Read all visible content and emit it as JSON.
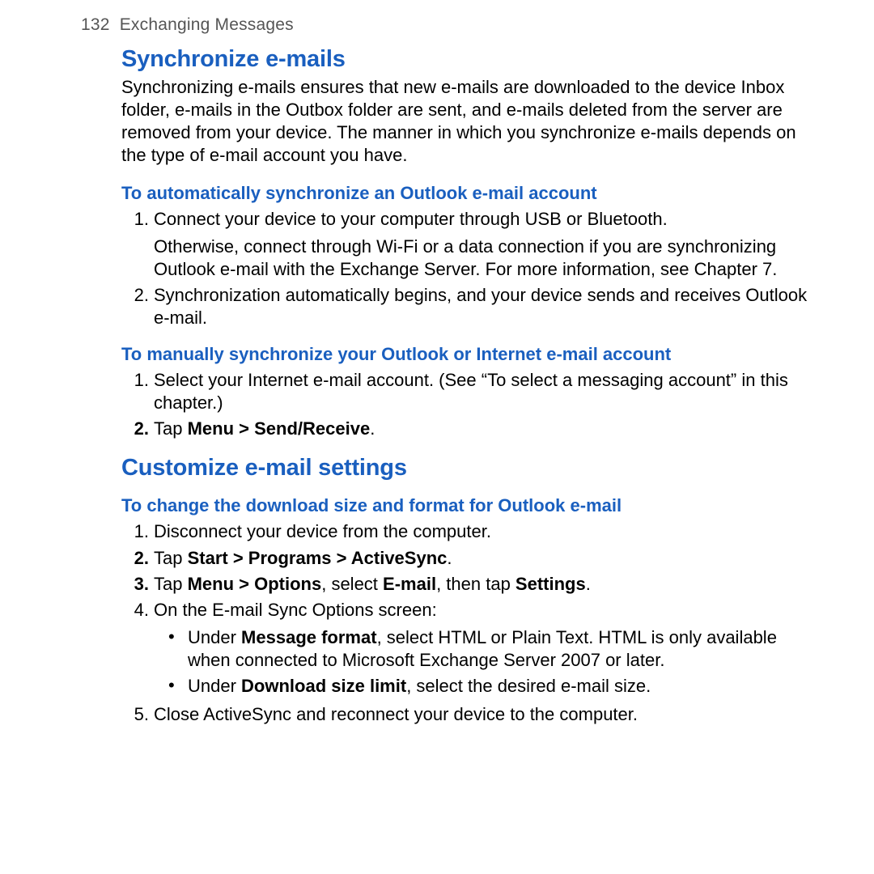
{
  "header": {
    "page_number": "132",
    "chapter": "Exchanging Messages"
  },
  "sections": [
    {
      "title": "Synchronize e-mails",
      "intro": "Synchronizing e-mails ensures that new e-mails are downloaded to the device Inbox folder, e-mails in the Outbox folder are sent, and e-mails deleted from the server are removed from your device. The manner in which you synchronize e-mails depends on the type of e-mail account you have.",
      "subs": [
        {
          "title": "To automatically synchronize an Outlook e-mail account",
          "items": [
            {
              "num": "1.",
              "bold_num": false,
              "text": "Connect your device to your computer through USB or Bluetooth.",
              "cont": "Otherwise, connect through Wi-Fi or a data connection if you are synchronizing Outlook e-mail with the Exchange Server. For more information, see Chapter 7."
            },
            {
              "num": "2.",
              "bold_num": false,
              "text": "Synchronization automatically begins, and your device sends and receives Outlook e-mail."
            }
          ]
        },
        {
          "title": "To manually synchronize your Outlook or Internet e-mail account",
          "items": [
            {
              "num": "1.",
              "bold_num": false,
              "text": "Select your Internet e-mail account. (See “To select a messaging account” in this chapter.)"
            },
            {
              "num": "2.",
              "bold_num": true,
              "html": "Tap <b>Menu > Send/Receive</b>."
            }
          ]
        }
      ]
    },
    {
      "title": "Customize e-mail settings",
      "subs": [
        {
          "title": "To change the download size and format for Outlook e-mail",
          "items": [
            {
              "num": "1.",
              "bold_num": false,
              "text": "Disconnect your device from the computer."
            },
            {
              "num": "2.",
              "bold_num": true,
              "html": "Tap <b>Start > Programs > ActiveSync</b>."
            },
            {
              "num": "3.",
              "bold_num": true,
              "html": "Tap <b>Menu > Options</b>, select <b>E-mail</b>, then tap <b>Settings</b>."
            },
            {
              "num": "4.",
              "bold_num": false,
              "text": "On the E-mail Sync Options screen:",
              "bullets": [
                "Under <b>Message format</b>, select HTML or Plain Text. HTML is only available when connected to Microsoft Exchange Server 2007 or later.",
                "Under <b>Download size limit</b>, select the desired e-mail size."
              ]
            },
            {
              "num": "5.",
              "bold_num": false,
              "text": "Close ActiveSync and reconnect your device to the computer."
            }
          ]
        }
      ]
    }
  ]
}
